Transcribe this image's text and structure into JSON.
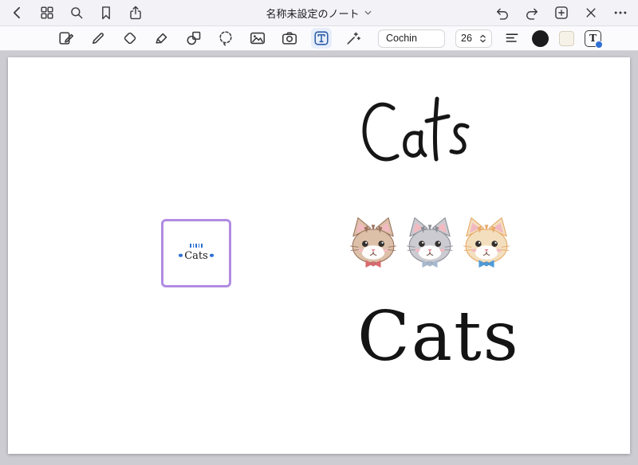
{
  "nav": {
    "title": "名称未設定のノート",
    "left_icons": [
      "back",
      "thumbnails",
      "search",
      "bookmark",
      "share"
    ],
    "right_icons": [
      "undo",
      "redo",
      "add-page",
      "close",
      "more"
    ]
  },
  "toolbar": {
    "tools": [
      "elements",
      "pen",
      "eraser",
      "highlighter",
      "shapes",
      "lasso",
      "image",
      "camera",
      "text",
      "laser-pointer"
    ],
    "active_tool": "text",
    "font_name": "Cochin",
    "font_size": "26",
    "text_style_label": "T"
  },
  "canvas": {
    "handwritten_text": "Cats",
    "sticker_preview_text": "Cats",
    "typed_text": "Cats"
  },
  "colors": {
    "accent_blue": "#2e6fd4",
    "selection_purple": "#b18ce2",
    "ink": "#161616",
    "canvas_gray": "#cdccd2",
    "text_color_swatch": "#1b1b1d"
  },
  "stickers": {
    "cats": [
      {
        "name": "brown-cat",
        "face": "#dcc0a8",
        "patch": "#9b7460",
        "inner_ear": "#f3b9c1",
        "bow": "#d96a6f"
      },
      {
        "name": "gray-cat",
        "face": "#cbcbd1",
        "patch": "#8e8e98",
        "inner_ear": "#f3b9c1",
        "bow": "#a5b9cf"
      },
      {
        "name": "cream-cat",
        "face": "#f3dfbe",
        "patch": "#e7a967",
        "inner_ear": "#f3b9c1",
        "bow": "#4f9bd8"
      }
    ]
  }
}
